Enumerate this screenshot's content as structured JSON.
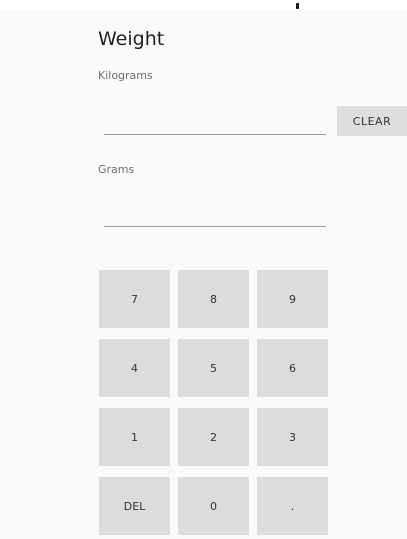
{
  "app": {
    "title": "Weight"
  },
  "fields": {
    "kilograms": {
      "label": "Kilograms",
      "value": ""
    },
    "grams": {
      "label": "Grams",
      "value": ""
    }
  },
  "buttons": {
    "clear_label": "CLEAR"
  },
  "keypad": {
    "keys": [
      "7",
      "8",
      "9",
      "4",
      "5",
      "6",
      "1",
      "2",
      "3",
      "DEL",
      "0",
      "."
    ]
  },
  "colors": {
    "background": "#fafafa",
    "key_background": "#dcdcdc",
    "underline": "#9e9e9e"
  }
}
